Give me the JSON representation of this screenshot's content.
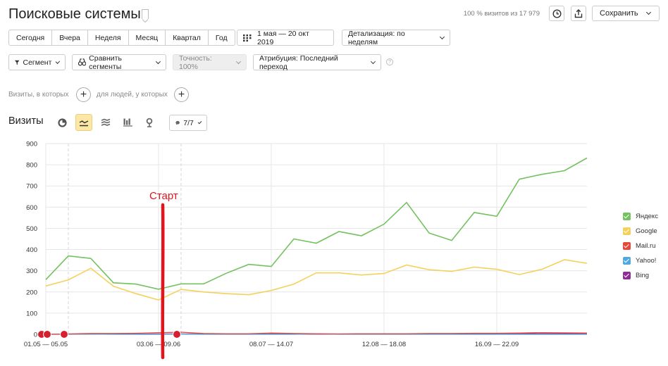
{
  "header": {
    "title": "Поисковые системы",
    "visits_share": "100 % визитов из 17 979",
    "save_label": "Сохранить"
  },
  "periods": [
    "Сегодня",
    "Вчера",
    "Неделя",
    "Месяц",
    "Квартал",
    "Год"
  ],
  "date_range": "1 мая — 20 окт 2019",
  "detail": "Детализация: по неделям",
  "filters": {
    "segment": "Сегмент",
    "compare": "Сравнить сегменты",
    "accuracy": "Точность: 100%",
    "attribution": "Атрибуция: Последний переход",
    "visits_where": "Визиты, в которых",
    "people_where": "для людей, у которых"
  },
  "chart_header": {
    "title": "Визиты",
    "series_count": "7/7"
  },
  "annotation": {
    "label": "Старт",
    "color": "#e8121b"
  },
  "colors": {
    "accent": "#fde7a4",
    "yandex": "#73c15f",
    "google": "#f5d15c",
    "mailru": "#e8473a",
    "yahoo": "#4fa8e0",
    "bing": "#8e2e95"
  },
  "chart_data": {
    "type": "line",
    "title": "",
    "xlabel": "",
    "ylabel": "",
    "ylim": [
      0,
      900
    ],
    "yticks": [
      0,
      100,
      200,
      300,
      400,
      500,
      600,
      700,
      800,
      900
    ],
    "x_labels": [
      "01.05 — 05.05",
      "03.06 — 09.06",
      "08.07 — 14.07",
      "12.08 — 18.08",
      "16.09 — 22.09"
    ],
    "x_label_index": [
      0,
      5,
      10,
      15,
      20
    ],
    "grid": true,
    "legend": "right",
    "series": [
      {
        "name": "Яндекс",
        "color": "#73c15f",
        "values": [
          258,
          370,
          358,
          243,
          237,
          213,
          238,
          238,
          288,
          330,
          320,
          450,
          430,
          485,
          465,
          520,
          622,
          478,
          443,
          575,
          557,
          732,
          755,
          772,
          832
        ]
      },
      {
        "name": "Google",
        "color": "#f5d15c",
        "values": [
          228,
          257,
          312,
          227,
          192,
          162,
          212,
          200,
          192,
          187,
          207,
          237,
          290,
          290,
          280,
          287,
          327,
          305,
          297,
          317,
          307,
          282,
          307,
          352,
          335
        ]
      },
      {
        "name": "Mail.ru",
        "color": "#e8473a",
        "values": [
          0,
          2,
          4,
          4,
          5,
          8,
          10,
          4,
          3,
          3,
          6,
          4,
          3,
          2,
          3,
          3,
          3,
          4,
          4,
          5,
          5,
          6,
          8,
          7,
          6
        ]
      },
      {
        "name": "Yahoo!",
        "color": "#4fa8e0",
        "values": [
          0,
          0,
          1,
          0,
          0,
          0,
          1,
          0,
          0,
          0,
          0,
          0,
          2,
          0,
          0,
          0,
          0,
          0,
          0,
          0,
          0,
          0,
          0,
          0,
          0
        ]
      },
      {
        "name": "Bing",
        "color": "#8e2e95",
        "values": [
          0,
          1,
          1,
          1,
          1,
          2,
          2,
          2,
          1,
          1,
          1,
          1,
          1,
          1,
          1,
          1,
          1,
          1,
          2,
          2,
          2,
          3,
          3,
          4,
          4
        ]
      }
    ],
    "event_markers": [
      0,
      0,
      1,
      6
    ]
  }
}
